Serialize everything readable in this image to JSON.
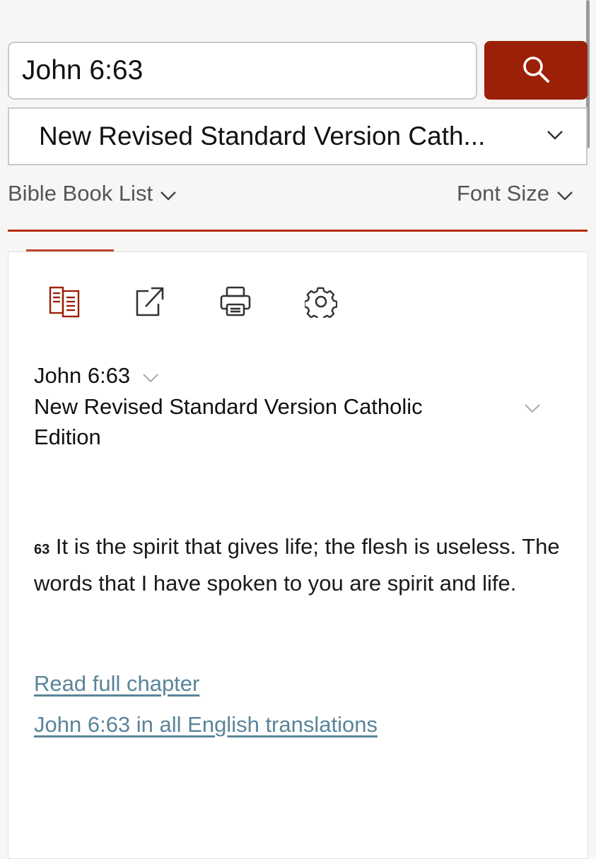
{
  "search": {
    "value": "John 6:63",
    "button_icon": "search-icon"
  },
  "version_select": {
    "selected": "New Revised Standard Version Cath..."
  },
  "nav": {
    "book_list": "Bible Book List",
    "font_size": "Font Size"
  },
  "tools": {
    "icons": [
      "parallel-view-icon",
      "share-icon",
      "print-icon",
      "settings-icon"
    ],
    "active_color": "#9b2007"
  },
  "passage": {
    "reference": "John 6:63",
    "version_line1": "New Revised Standard Version Catholic",
    "version_line2": "Edition",
    "verse_number": "63",
    "verse_text": "It is the spirit that gives life; the flesh is useless. The words that I have spoken to you are spirit and life.",
    "read_full_chapter": "Read full chapter",
    "all_translations": "John 6:63 in all English translations"
  },
  "colors": {
    "accent": "#9b2007",
    "link": "#5b8499",
    "rule": "#b52b0f"
  }
}
